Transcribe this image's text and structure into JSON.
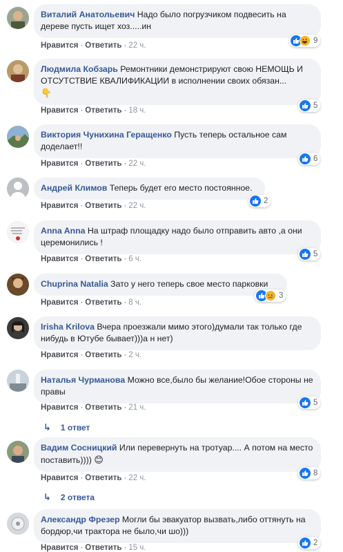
{
  "labels": {
    "like": "Нравится",
    "reply": "Ответить",
    "dot": "·"
  },
  "comments": [
    {
      "author": "Виталий Анатольевич",
      "text": "Надо было погрузчиком подвесить на дереве пусть ищет хоз.....ин",
      "time": "22 ч.",
      "reactions": [
        "like",
        "haha"
      ],
      "count": "9",
      "avatar_color": "#5a6b5a"
    },
    {
      "author": "Людмила Кобзарь",
      "text": "Ремонтники демонстрируют свою НЕМОЩЬ И ОТСУТСТВИЕ КВАЛИФИКАЦИИ в исполнении своих обязан...",
      "text_emoji": "👇",
      "time": "18 ч.",
      "reactions": [
        "like"
      ],
      "count": "5",
      "avatar_color": "#8a6d4a"
    },
    {
      "author": "Виктория Чунихина Геращенко",
      "text": "Пусть теперь остальное сам доделает!!",
      "time": "22 ч.",
      "reactions": [
        "like"
      ],
      "count": "6",
      "avatar_color": "#6c8aa8"
    },
    {
      "author": "Андрей Климов",
      "text": "Теперь будет его место постоянное.",
      "time": "22 ч.",
      "reactions": [
        "like"
      ],
      "count": "2",
      "avatar_color": "#bcc0c4"
    },
    {
      "author": "Anna Anna",
      "text": "На штраф площадку надо было отправить авто ,а они церемонились !",
      "time": "6 ч.",
      "reactions": [
        "like"
      ],
      "count": "5",
      "avatar_color": "#e9e9e9"
    },
    {
      "author": "Chuprina Natalia",
      "text": "Зато у него теперь свое место парковки",
      "time": "8 ч.",
      "reactions": [
        "like",
        "sad"
      ],
      "count": "3",
      "avatar_color": "#7a5a3a"
    },
    {
      "author": "Irisha Krilova",
      "text": "Вчера проезжали мимо этого)думали так только где нибудь в Ютубе бывает)))а н нет)",
      "time": "2 ч.",
      "reactions": [],
      "count": "",
      "avatar_color": "#4a4a4a"
    },
    {
      "author": "Наталья Чурманова",
      "text": "Можно все,было бы желание!Обое стороны не правы",
      "time": "21 ч.",
      "reactions": [
        "like"
      ],
      "count": "5",
      "avatar_color": "#9aa7b0",
      "replies": "1 ответ"
    },
    {
      "author": "Вадим Сосницкий",
      "text": "Или перевернуть на тротуар.... А потом на место поставить))))",
      "text_emoji": "😊",
      "time": "22 ч.",
      "reactions": [
        "like"
      ],
      "count": "8",
      "avatar_color": "#7b8a6b",
      "replies": "2 ответа"
    },
    {
      "author": "Александр Фрезер",
      "text": "Могли бы эвакуатор вызвать,либо оттянуть на бордюр,чи трактора не было,чи шо)))",
      "time": "15 ч.",
      "reactions": [
        "like"
      ],
      "count": "2",
      "avatar_color": "#c8ccd0"
    }
  ]
}
